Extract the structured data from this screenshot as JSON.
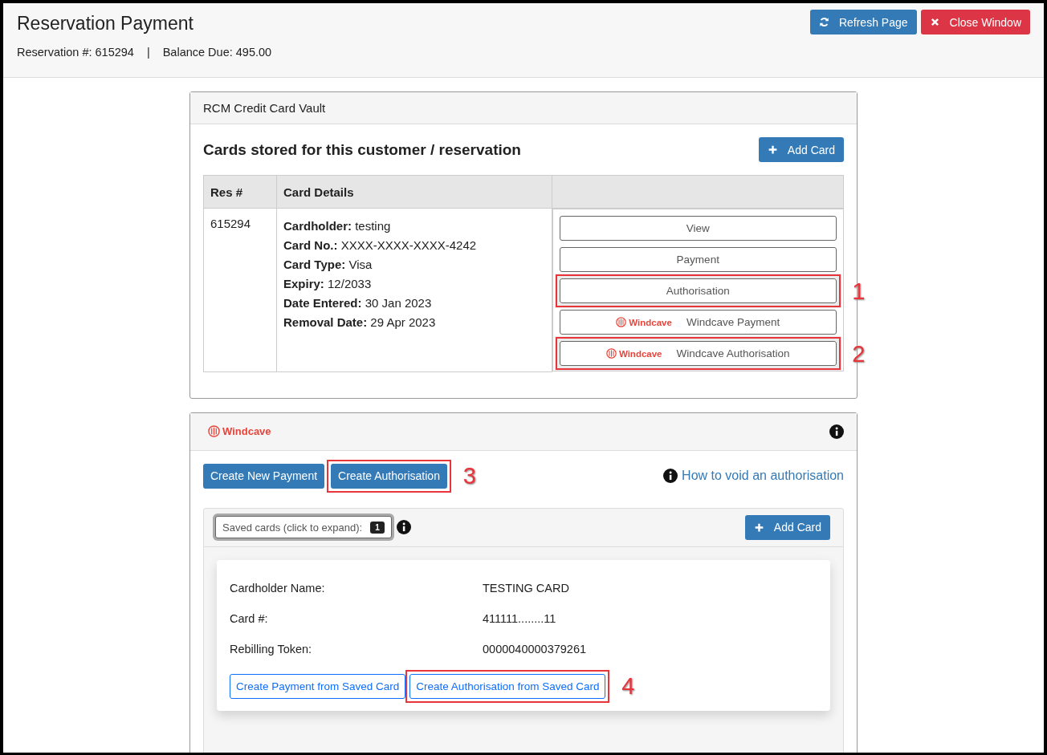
{
  "header": {
    "title": "Reservation Payment",
    "reservation": "Reservation #: 615294",
    "separator": "|",
    "balance": "Balance Due: 495.00",
    "buttons": [
      {
        "kind": "refresh",
        "label": "Refresh Page"
      },
      {
        "kind": "close",
        "label": "Close Window"
      }
    ]
  },
  "vault": {
    "title": "RCM Credit Card Vault",
    "heading": "Cards stored for this customer / reservation",
    "add_button": "Add Card",
    "table": {
      "columns": [
        "Res #",
        "Card Details",
        ""
      ],
      "rows": [
        {
          "res": "615294",
          "details": [
            {
              "label": "Cardholder:",
              "value": "testing"
            },
            {
              "label": "Card No.:",
              "value": "XXXX-XXXX-XXXX-4242"
            },
            {
              "label": "Card Type:",
              "value": "Visa"
            },
            {
              "label": "Expiry:",
              "value": "12/2033"
            },
            {
              "label": "Date Entered:",
              "value": "30 Jan 2023"
            },
            {
              "label": "Removal Date:",
              "value": "29 Apr 2023"
            }
          ],
          "actions": [
            {
              "kind": "plain",
              "label": "View"
            },
            {
              "kind": "plain",
              "label": "Payment"
            },
            {
              "kind": "plain",
              "label": "Authorisation",
              "callout": "1"
            },
            {
              "kind": "windcave",
              "brand": "Windcave",
              "label": "Windcave Payment"
            },
            {
              "kind": "windcave",
              "brand": "Windcave",
              "label": "Windcave Authorisation",
              "callout": "2"
            }
          ]
        }
      ]
    }
  },
  "windcave": {
    "brand": "Windcave",
    "buttons": [
      {
        "label": "Create New Payment"
      },
      {
        "label": "Create Authorisation",
        "callout": "3"
      }
    ],
    "help_link": "How to void an authorisation",
    "saved": {
      "toggle": "Saved cards (click to expand):",
      "count": "1",
      "add_button": "Add Card",
      "card": {
        "fields": [
          {
            "label": "Cardholder Name:",
            "value": "TESTING CARD"
          },
          {
            "label": "Card #:",
            "value": "411111........11"
          },
          {
            "label": "Rebilling Token:",
            "value": "0000040000379261"
          }
        ],
        "buttons": [
          {
            "label": "Create Payment from Saved Card"
          },
          {
            "label": "Create Authorisation from Saved Card",
            "callout": "4"
          }
        ]
      }
    }
  }
}
